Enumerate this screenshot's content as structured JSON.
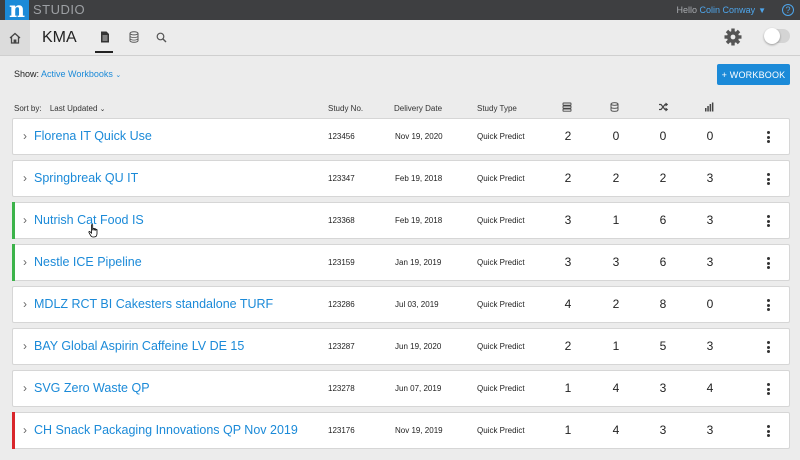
{
  "topbar": {
    "logo_letter": "n",
    "app_name": "STUDIO",
    "greeting_prefix": "Hello",
    "user_name": "Colin Conway",
    "help": "?"
  },
  "navbar": {
    "project_title": "KMA"
  },
  "toolbar": {
    "show_label": "Show:",
    "show_value": "Active Workbooks",
    "new_workbook_label": "+ WORKBOOK"
  },
  "table": {
    "sort_label": "Sort by:",
    "sort_value": "Last Updated",
    "columns": {
      "study_no": "Study No.",
      "delivery_date": "Delivery Date",
      "study_type": "Study Type"
    },
    "rows": [
      {
        "title": "Florena IT Quick Use",
        "study_no": "123456",
        "delivery_date": "Nov 19, 2020",
        "study_type": "Quick Predict",
        "c1": "2",
        "c2": "0",
        "c3": "0",
        "c4": "0",
        "accent": ""
      },
      {
        "title": "Springbreak QU IT",
        "study_no": "123347",
        "delivery_date": "Feb 19, 2018",
        "study_type": "Quick Predict",
        "c1": "2",
        "c2": "2",
        "c3": "2",
        "c4": "3",
        "accent": ""
      },
      {
        "title": "Nutrish Cat Food IS",
        "study_no": "123368",
        "delivery_date": "Feb 19, 2018",
        "study_type": "Quick Predict",
        "c1": "3",
        "c2": "1",
        "c3": "6",
        "c4": "3",
        "accent": "#3cb34a"
      },
      {
        "title": "Nestle ICE Pipeline",
        "study_no": "123159",
        "delivery_date": "Jan 19, 2019",
        "study_type": "Quick Predict",
        "c1": "3",
        "c2": "3",
        "c3": "6",
        "c4": "3",
        "accent": "#3cb34a"
      },
      {
        "title": "MDLZ RCT BI Cakesters standalone TURF",
        "study_no": "123286",
        "delivery_date": "Jul 03, 2019",
        "study_type": "Quick Predict",
        "c1": "4",
        "c2": "2",
        "c3": "8",
        "c4": "0",
        "accent": ""
      },
      {
        "title": "BAY Global Aspirin Caffeine LV DE 15",
        "study_no": "123287",
        "delivery_date": "Jun 19, 2020",
        "study_type": "Quick Predict",
        "c1": "2",
        "c2": "1",
        "c3": "5",
        "c4": "3",
        "accent": ""
      },
      {
        "title": "SVG Zero Waste QP",
        "study_no": "123278",
        "delivery_date": "Jun 07, 2019",
        "study_type": "Quick Predict",
        "c1": "1",
        "c2": "4",
        "c3": "3",
        "c4": "4",
        "accent": ""
      },
      {
        "title": "CH Snack Packaging Innovations QP Nov 2019",
        "study_no": "123176",
        "delivery_date": "Nov 19, 2019",
        "study_type": "Quick Predict",
        "c1": "1",
        "c2": "4",
        "c3": "3",
        "c4": "3",
        "accent": "#d9262b"
      }
    ]
  },
  "colors": {
    "brand_blue": "#1b8ad8",
    "accent_green": "#3cb34a",
    "accent_red": "#d9262b"
  },
  "icons": {
    "home": "home-icon",
    "document": "document-icon",
    "database": "database-icon",
    "search": "search-icon",
    "settings": "gear-icon",
    "row_expand": "chevron-right-icon",
    "row_menu": "kebab-menu-icon"
  }
}
